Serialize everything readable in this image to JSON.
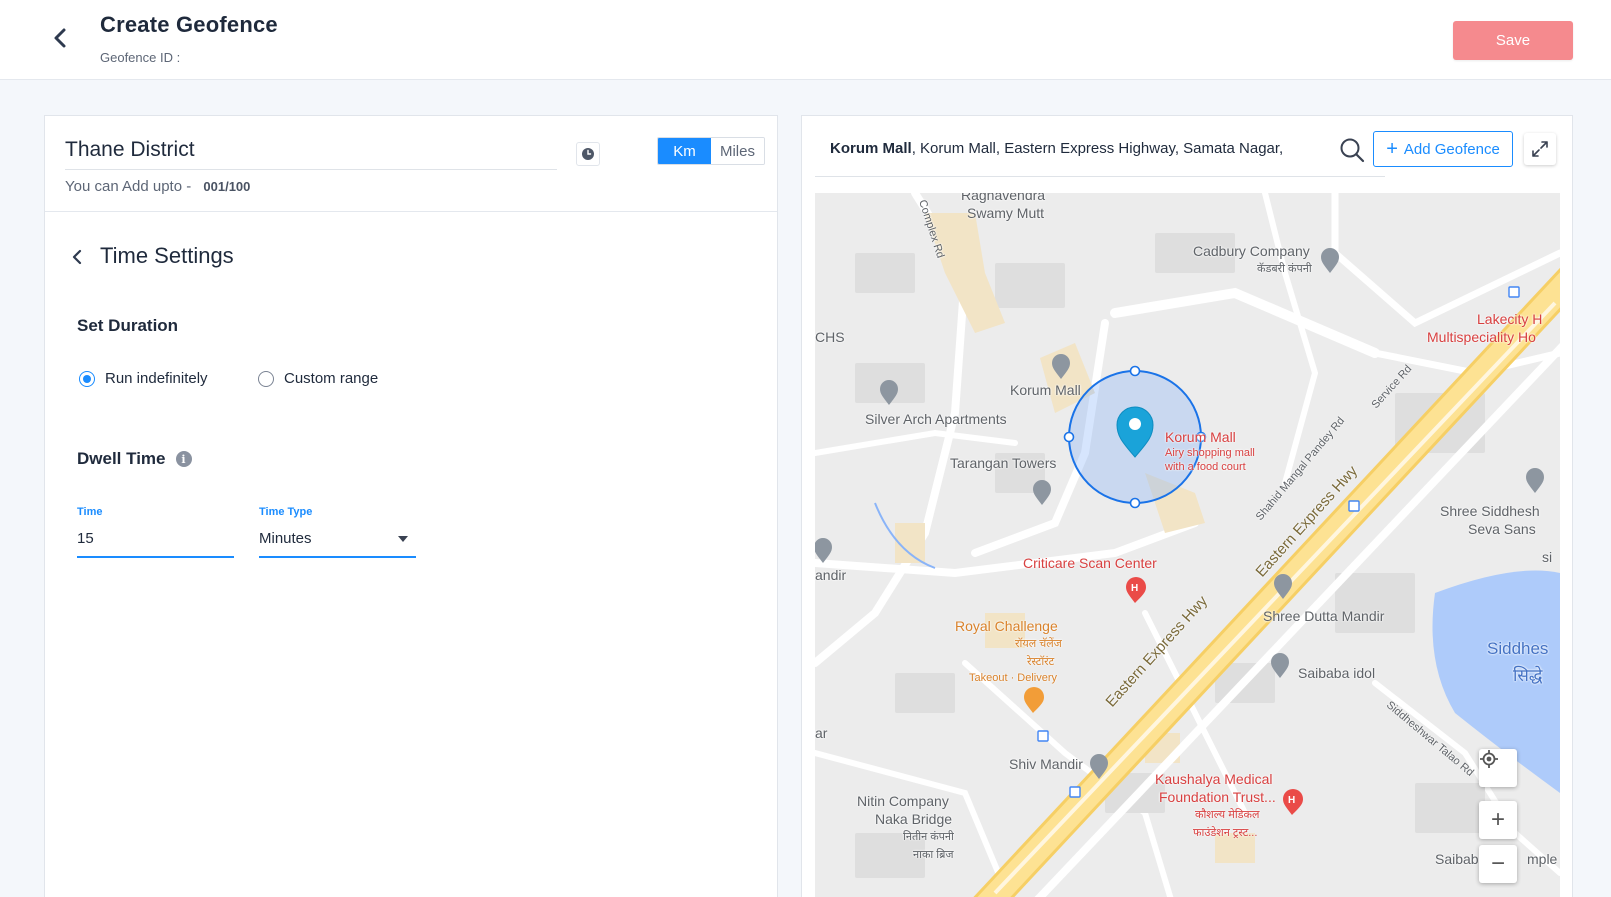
{
  "header": {
    "title": "Create Geofence",
    "geofence_id_label": "Geofence ID :",
    "save_label": "Save",
    "save_color": "#f58a8e"
  },
  "left_panel": {
    "region_name": "Thane District",
    "units": {
      "km": "Km",
      "miles": "Miles",
      "selected": "Km"
    },
    "add_upto_label": "You can Add upto -",
    "add_upto_count": "001/100",
    "section_title": "Time Settings",
    "set_duration": {
      "title": "Set Duration",
      "options": [
        {
          "label": "Run indefinitely",
          "checked": true
        },
        {
          "label": "Custom range",
          "checked": false
        }
      ]
    },
    "dwell_time": {
      "title": "Dwell Time",
      "info_icon": "info-icon",
      "time_label": "Time",
      "time_value": "15",
      "time_type_label": "Time Type",
      "time_type_value": "Minutes"
    }
  },
  "right_panel": {
    "address_bold": "Korum Mall",
    "address_rest": ", Korum Mall, Eastern Express Highway, Samata Nagar,",
    "add_geofence_label": "Add Geofence",
    "accent_color": "#1a8cff",
    "map": {
      "labels": {
        "raghavendra_1": "Raghavendra",
        "raghavendra_2": "Swamy Mutt",
        "complex_rd": "Complex Rd",
        "cadbury": "Cadbury Company",
        "cadbury_hi": "कॅडबरी कंपनी",
        "lakecity_1": "Lakecity H",
        "lakecity_2": "Multispeciality Ho",
        "chs": "CHS",
        "korum_mall_grey": "Korum Mall",
        "silver_arch": "Silver Arch Apartments",
        "korum_mall_red": "Korum Mall",
        "korum_desc_1": "Airy shopping mall",
        "korum_desc_2": "with a food court",
        "tarangan": "Tarangan Towers",
        "shahid_rd": "Shahid Mangal Pandey Rd",
        "service_rd": "Service Rd",
        "eastern_hwy_1": "Eastern Express Hwy",
        "eastern_hwy_2": "Eastern Express Hwy",
        "shree_siddhesh_1": "Shree Siddhesh",
        "shree_siddhesh_2": "Seva Sans",
        "si": "si",
        "mandir_left": "andir",
        "criticare": "Criticare Scan Center",
        "shree_dutta": "Shree Dutta Mandir",
        "royal_1": "Royal Challenge",
        "royal_2": "रॉयल चॅलेंज",
        "royal_3": "रेस्टॉरंट",
        "royal_4": "Takeout · Delivery",
        "siddhesh_lake_1": "Siddhes",
        "siddhesh_lake_2": "सिद्धे",
        "saibaba": "Saibaba idol",
        "ar": "ar",
        "siddheshwar_rd": "Siddheshwar Talao Rd",
        "shiv_mandir": "Shiv Mandir",
        "kaushalya_1": "Kaushalya Medical",
        "kaushalya_2": "Foundation Trust...",
        "kaushalya_3": "कौशल्य मेडिकल",
        "kaushalya_4": "फाउंडेशन ट्रस्ट...",
        "nitin_1": "Nitin Company",
        "nitin_2": "Naka Bridge",
        "nitin_3": "नितीन कंपनी",
        "nitin_4": "नाका ब्रिज",
        "saibab_bottom": "Saibab",
        "temple_bottom": "mple"
      }
    }
  }
}
